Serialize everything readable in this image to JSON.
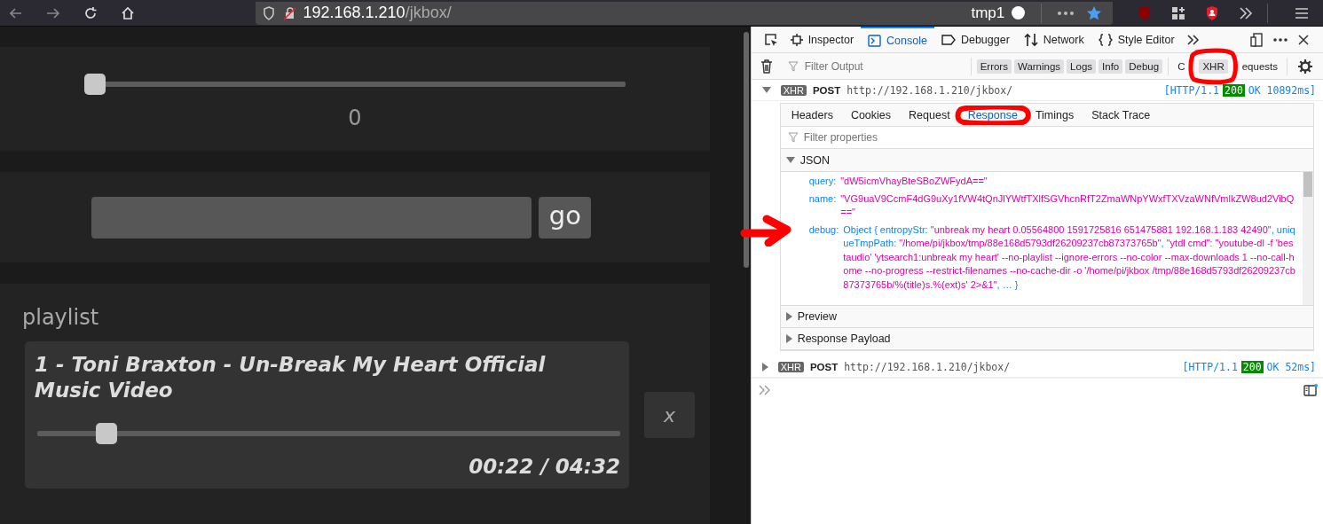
{
  "browser": {
    "url_host": "192.168.1.210",
    "url_path": "/jkbox/",
    "container_label": "tmp1"
  },
  "page": {
    "volume": {
      "level": 0.0,
      "reading": "0"
    },
    "search": {
      "button": "go"
    },
    "playlist": {
      "heading": "playlist",
      "items": [
        {
          "title": "1 - Toni Braxton - Un-Break My Heart Official Music Video",
          "level": 0.1,
          "time": "00:22 / 04:32",
          "remove": "x"
        }
      ]
    }
  },
  "devtools": {
    "tabs": [
      {
        "label": "Inspector",
        "kind": "inspector",
        "selected": false
      },
      {
        "label": "Console",
        "kind": "console",
        "selected": true
      },
      {
        "label": "Debugger",
        "kind": "debugger",
        "selected": false
      },
      {
        "label": "Network",
        "kind": "network",
        "selected": false
      },
      {
        "label": "Style Editor",
        "kind": "style",
        "selected": false
      }
    ],
    "filter_placeholder": "Filter Output",
    "filters": [
      {
        "label": "Errors",
        "selected": true
      },
      {
        "label": "Warnings",
        "selected": true
      },
      {
        "label": "Logs",
        "selected": true
      },
      {
        "label": "Info",
        "selected": true
      },
      {
        "label": "Debug",
        "selected": true
      },
      {
        "label": "C",
        "selected": false
      },
      {
        "label": "XHR",
        "selected": true,
        "circled": true
      },
      {
        "label": "equests",
        "selected": false
      }
    ],
    "messages": [
      {
        "badge": "XHR",
        "method": "POST",
        "url": "http://192.168.1.210/jkbox/",
        "protocol": "[HTTP/1.1",
        "status": "200",
        "result": "OK 10892ms]",
        "expanded": true,
        "detail": {
          "tabs": [
            {
              "label": "Headers",
              "selected": false
            },
            {
              "label": "Cookies",
              "selected": false
            },
            {
              "label": "Request",
              "selected": false
            },
            {
              "label": "Response",
              "selected": true,
              "circled": true
            },
            {
              "label": "Timings",
              "selected": false
            },
            {
              "label": "Stack Trace",
              "selected": false
            }
          ],
          "filter_placeholder": "Filter properties",
          "section": "JSON",
          "properties": [
            {
              "key": "query:",
              "parts": [
                {
                  "kind": "string",
                  "text": "\"dW5icmVhayBteSBoZWFydA==\""
                }
              ]
            },
            {
              "key": "name:",
              "parts": [
                {
                  "kind": "string",
                  "text": "\"VG9uaV9CcmF4dG9uXy1fVW4tQnJlYWtfTXlfSGVhcnRfT2ZmaWNpYWxfTXVzaWNfVmlkZW8ud2VibQ==\""
                }
              ]
            },
            {
              "key": "debug:",
              "arrow": true,
              "parts": [
                {
                  "kind": "key",
                  "text": "Object { entropyStr: "
                },
                {
                  "kind": "string",
                  "text": "\"unbreak my heart 0.05564800 1591725816 651475881 192.168.1.183 42490\""
                },
                {
                  "kind": "key",
                  "text": ", uniqueTmpPath: "
                },
                {
                  "kind": "string",
                  "text": "\"/home/pi/jkbox/tmp/88e168d5793df26209237cb87373765b\""
                },
                {
                  "kind": "key",
                  "text": ", "
                },
                {
                  "kind": "string",
                  "text": "\"ytdl cmd\""
                },
                {
                  "kind": "key",
                  "text": ": "
                },
                {
                  "kind": "string",
                  "text": "\"youtube-dl -f 'bestaudio' 'ytsearch1:unbreak my heart' --no-playlist --ignore-errors --no-color --max-downloads 1 --no-call-home --no-progress --restrict-filenames --no-cache-dir -o '/home/pi/jkbox /tmp/88e168d5793df26209237cb87373765b/%(title)s.%(ext)s' 2>&1\""
                },
                {
                  "kind": "key",
                  "text": ", … }"
                }
              ]
            }
          ],
          "sections": [
            {
              "label": "Preview",
              "expanded": false
            },
            {
              "label": "Response Payload",
              "expanded": false
            }
          ]
        }
      },
      {
        "badge": "XHR",
        "method": "POST",
        "url": "http://192.168.1.210/jkbox/",
        "protocol": "[HTTP/1.1",
        "status": "200",
        "result": "OK 52ms]",
        "expanded": false
      }
    ]
  }
}
